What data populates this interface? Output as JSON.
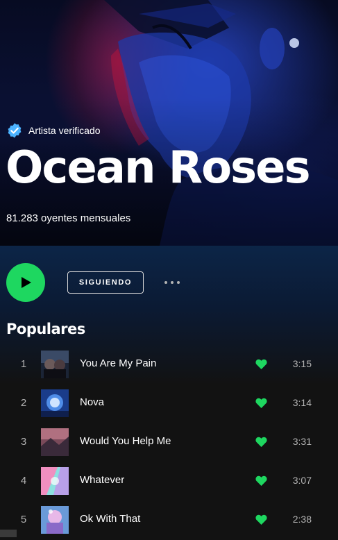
{
  "artist": {
    "verified_label": "Artista verificado",
    "name": "Ocean Roses",
    "monthly_listeners": "81.283 oyentes mensuales"
  },
  "actions": {
    "play_icon": "play-icon",
    "follow_label": "SIGUIENDO",
    "more_icon": "more-options-icon"
  },
  "popular": {
    "title": "Populares",
    "tracks": [
      {
        "number": "1",
        "title": "You Are My Pain",
        "duration": "3:15",
        "liked": true
      },
      {
        "number": "2",
        "title": "Nova",
        "duration": "3:14",
        "liked": true
      },
      {
        "number": "3",
        "title": "Would You Help Me",
        "duration": "3:31",
        "liked": true
      },
      {
        "number": "4",
        "title": "Whatever",
        "duration": "3:07",
        "liked": true
      },
      {
        "number": "5",
        "title": "Ok With That",
        "duration": "2:38",
        "liked": true
      }
    ]
  },
  "colors": {
    "accent_green": "#1ed760",
    "background": "#121212",
    "verified_blue": "#4cb3ff",
    "secondary_text": "#b3b3b3"
  }
}
